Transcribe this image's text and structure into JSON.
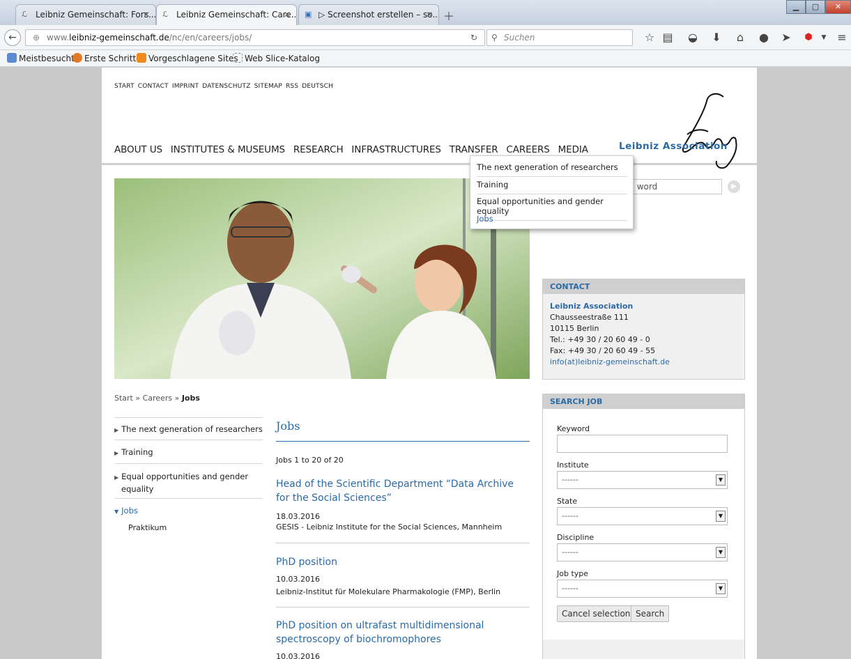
{
  "browser": {
    "tabs": [
      {
        "label": "Leibniz Gemeinschaft: Fors...",
        "active": false
      },
      {
        "label": "Leibniz Gemeinschaft: Care...",
        "active": true
      },
      {
        "label": "▷ Screenshot erstellen – so...",
        "active": false
      }
    ],
    "url_prefix": "www.",
    "url_host": "leibniz-gemeinschaft.de",
    "url_path": "/nc/en/careers/jobs/",
    "search_placeholder": "Suchen",
    "bookmarks": [
      "Meistbesucht",
      "Erste Schritte",
      "Vorgeschlagene Sites",
      "Web Slice-Katalog"
    ]
  },
  "site": {
    "top_links": [
      "START",
      "CONTACT",
      "IMPRINT",
      "DATENSCHUTZ",
      "SITEMAP",
      "RSS",
      "DEUTSCH"
    ],
    "main_nav": [
      "ABOUT US",
      "INSTITUTES & MUSEUMS",
      "RESEARCH",
      "INFRASTRUCTURES",
      "TRANSFER",
      "CAREERS",
      "MEDIA"
    ],
    "logo_script": "Leibniz",
    "logo_text": "Leibniz Association",
    "careers_dropdown": [
      "The next generation of researchers",
      "Training",
      "Equal opportunities and gender equality",
      "Jobs"
    ],
    "search_placeholder": "rch word",
    "breadcrumb": {
      "start": "Start",
      "sep": "»",
      "careers": "Careers",
      "current": "Jobs"
    },
    "side_nav": {
      "items": [
        "The next generation of researchers",
        "Training",
        "Equal opportunities and gender equality",
        "Jobs"
      ],
      "sub_item": "Praktikum"
    }
  },
  "contact": {
    "heading": "CONTACT",
    "org": "Leibniz Association",
    "street": "Chausseestraße 111",
    "city": "10115 Berlin",
    "tel": "Tel.: +49 30 / 20 60 49 - 0",
    "fax": "Fax: +49 30 / 20 60 49 - 55",
    "email": "info(at)leibniz-gemeinschaft.de"
  },
  "search_job": {
    "heading": "SEARCH JOB",
    "keyword_label": "Keyword",
    "institute_label": "Institute",
    "state_label": "State",
    "discipline_label": "Discipline",
    "jobtype_label": "Job type",
    "select_value": "------",
    "cancel_label": "Cancel selection",
    "search_label": "Search"
  },
  "jobs": {
    "title": "Jobs",
    "count": "Jobs 1 to 20 of 20",
    "items": [
      {
        "title": "Head of the Scientific Department “Data Archive for the Social Sciences”",
        "date": "18.03.2016",
        "institute": "GESIS - Leibniz Institute for the Social Sciences, Mannheim"
      },
      {
        "title": "PhD position",
        "date": "10.03.2016",
        "institute": "Leibniz-Institut für Molekulare Pharmakologie (FMP), Berlin"
      },
      {
        "title": "PhD position on ultrafast multidimensional spectroscopy of biochromophores",
        "date": "10.03.2016",
        "institute": ""
      }
    ]
  }
}
